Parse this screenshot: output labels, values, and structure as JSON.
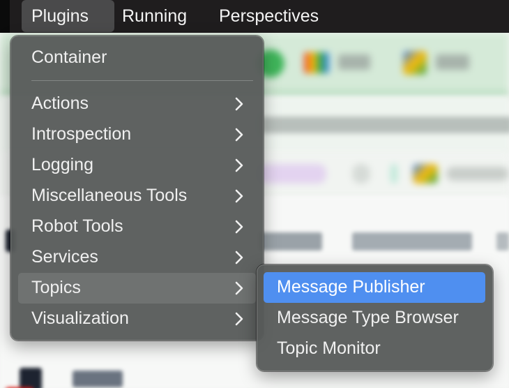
{
  "menubar": {
    "items": [
      "Plugins",
      "Running",
      "Perspectives"
    ],
    "active_index": 0
  },
  "plugins_menu": {
    "header_item": "Container",
    "items": [
      {
        "label": "Actions",
        "has_submenu": true
      },
      {
        "label": "Introspection",
        "has_submenu": true
      },
      {
        "label": "Logging",
        "has_submenu": true
      },
      {
        "label": "Miscellaneous Tools",
        "has_submenu": true
      },
      {
        "label": "Robot Tools",
        "has_submenu": true
      },
      {
        "label": "Services",
        "has_submenu": true
      },
      {
        "label": "Topics",
        "has_submenu": true
      },
      {
        "label": "Visualization",
        "has_submenu": true
      }
    ],
    "highlighted_item": "Topics",
    "chevron_icon": "chevron-right-icon"
  },
  "topics_submenu": {
    "items": [
      "Message Publisher",
      "Message Type Browser",
      "Topic Monitor"
    ],
    "selected_item": "Message Publisher"
  },
  "colors": {
    "menu_background": "#575a59",
    "selected_accent": "#4f8ff0",
    "hover_row": "#6f7271",
    "menubar_background": "#1f1d1e"
  }
}
